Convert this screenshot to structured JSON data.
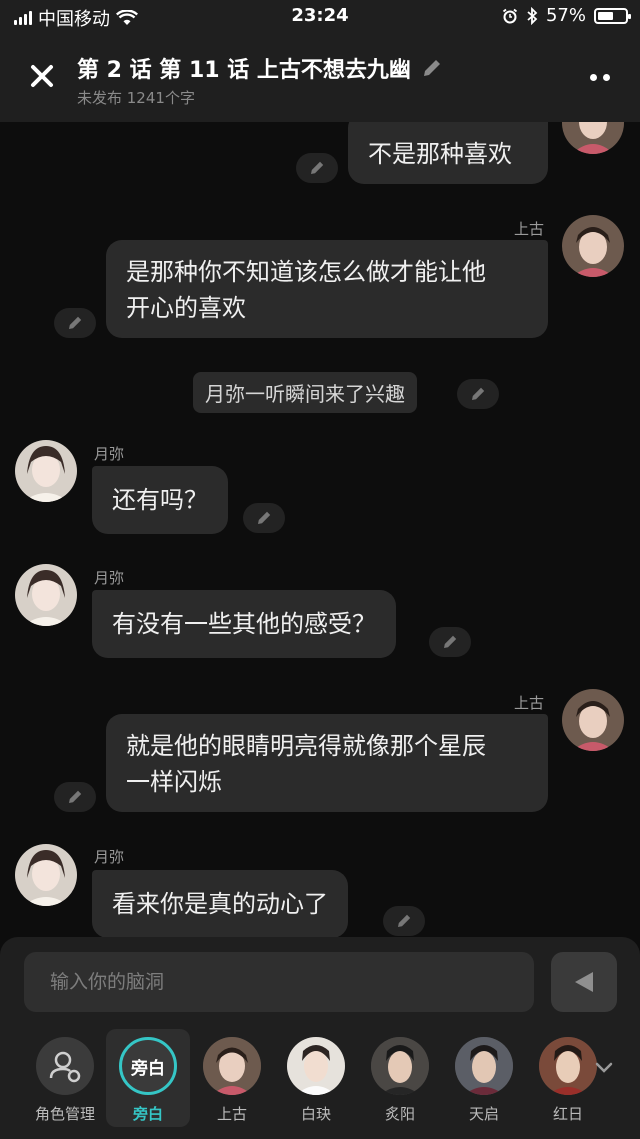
{
  "status_bar": {
    "carrier": "中国移动",
    "time": "23:24",
    "battery_percent": "57%",
    "battery_level": 0.57
  },
  "header": {
    "title": "第 2 话  第 11 话  上古不想去九幽",
    "subtitle": "未发布 1241个字"
  },
  "messages": [
    {
      "side": "right",
      "speaker": "",
      "text": "不是那种喜欢"
    },
    {
      "side": "right",
      "speaker": "上古",
      "line1": "是那种你不知道该怎么做才能让他",
      "line2": "开心的喜欢"
    },
    {
      "side": "center",
      "text": "月弥一听瞬间来了兴趣"
    },
    {
      "side": "left",
      "speaker": "月弥",
      "text": "还有吗？"
    },
    {
      "side": "left",
      "speaker": "月弥",
      "text": "有没有一些其他的感受？"
    },
    {
      "side": "right",
      "speaker": "上古",
      "line1": "就是他的眼睛明亮得就像那个星辰",
      "line2": "一样闪烁"
    },
    {
      "side": "left",
      "speaker": "月弥",
      "text": "看来你是真的动心了"
    }
  ],
  "composer": {
    "placeholder": "输入你的脑洞"
  },
  "roles": [
    {
      "label": "角色管理",
      "icon": "person-gear-icon"
    },
    {
      "label": "旁白",
      "badge": "旁白",
      "active": true
    },
    {
      "label": "上古"
    },
    {
      "label": "白玦"
    },
    {
      "label": "炙阳"
    },
    {
      "label": "天启"
    },
    {
      "label": "红日"
    }
  ],
  "colors": {
    "accent": "#35c6c6",
    "background": "#0d0d0d",
    "bubble": "#2b2b2b",
    "bar": "#1f1f1f"
  }
}
